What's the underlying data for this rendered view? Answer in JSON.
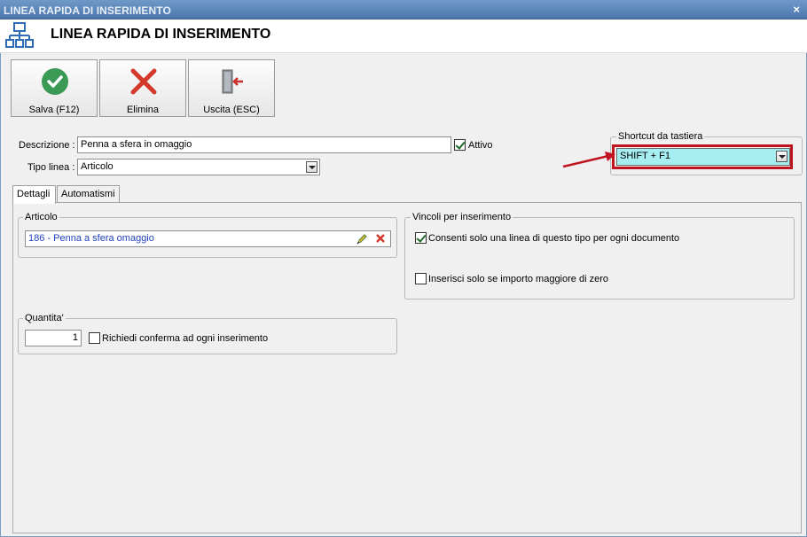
{
  "window": {
    "title": "LINEA RAPIDA DI INSERIMENTO",
    "close_glyph": "×"
  },
  "header": {
    "title": "LINEA RAPIDA DI INSERIMENTO",
    "icon": "org-chart-icon"
  },
  "toolbar": {
    "save_label": "Salva (F12)",
    "delete_label": "Elimina",
    "exit_label": "Uscita (ESC)"
  },
  "form": {
    "descrizione_label": "Descrizione :",
    "descrizione_value": "Penna a sfera in omaggio",
    "attivo_label": "Attivo",
    "attivo_checked": true,
    "tipo_linea_label": "Tipo linea :",
    "tipo_linea_value": "Articolo"
  },
  "shortcut": {
    "group_label": "Shortcut da tastiera",
    "value": "SHIFT + F1"
  },
  "tabs": [
    {
      "label": "Dettagli",
      "active": true
    },
    {
      "label": "Automatismi",
      "active": false
    }
  ],
  "articolo": {
    "group_label": "Articolo",
    "value": "186 - Penna a sfera omaggio"
  },
  "quantita": {
    "group_label": "Quantita'",
    "value": "1",
    "confirm_label": "Richiedi conferma ad ogni inserimento",
    "confirm_checked": false
  },
  "vincoli": {
    "group_label": "Vincoli per inserimento",
    "one_line_label": "Consenti solo una linea di questo tipo per ogni documento",
    "one_line_checked": true,
    "amount_label": "Inserisci solo se importo maggiore di zero",
    "amount_checked": false
  },
  "colors": {
    "accent_blue": "#4a77ad",
    "save_green": "#3a9a55",
    "delete_red": "#d33a2c",
    "shortcut_bg": "#a6eef2",
    "highlight_red": "#c1121f",
    "link_blue": "#1f3fbf"
  }
}
